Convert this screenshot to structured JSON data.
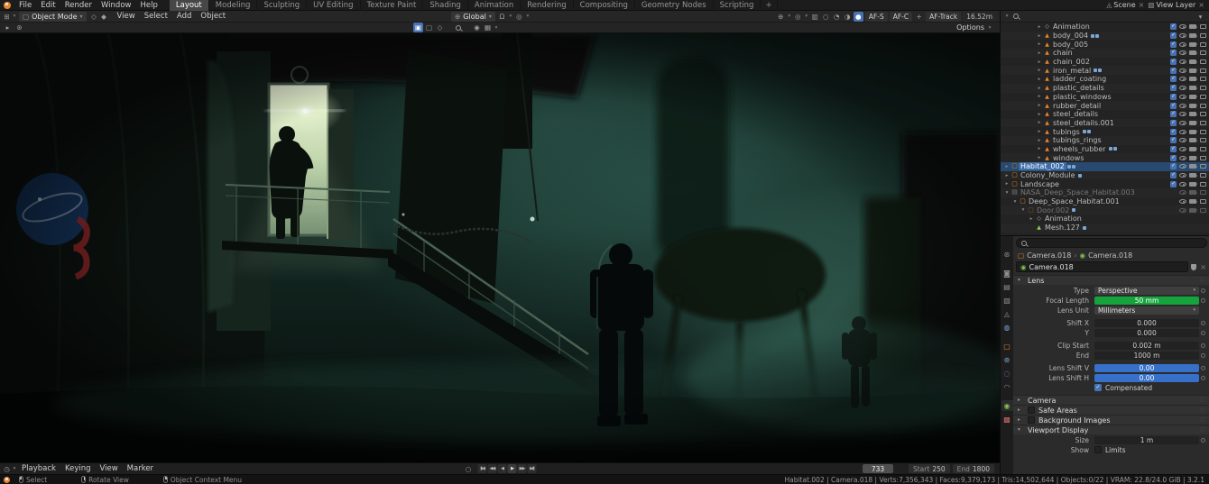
{
  "colors": {
    "accent": "#4772b3",
    "slider_green": "#15a33c",
    "field_blue": "#3670c9",
    "object_orange": "#e8862d",
    "selected_row": "#284a70"
  },
  "topbar": {
    "menus": [
      "File",
      "Edit",
      "Render",
      "Window",
      "Help"
    ],
    "workspaces": [
      {
        "label": "Layout",
        "cls": "active"
      },
      {
        "label": "Modeling",
        "cls": ""
      },
      {
        "label": "Sculpting",
        "cls": ""
      },
      {
        "label": "UV Editing",
        "cls": ""
      },
      {
        "label": "Texture Paint",
        "cls": ""
      },
      {
        "label": "Shading",
        "cls": ""
      },
      {
        "label": "Animation",
        "cls": ""
      },
      {
        "label": "Rendering",
        "cls": ""
      },
      {
        "label": "Compositing",
        "cls": ""
      },
      {
        "label": "Geometry Nodes",
        "cls": ""
      },
      {
        "label": "Scripting",
        "cls": ""
      }
    ],
    "add_workspace": "+",
    "scene": "Scene",
    "view_layer": "View Layer"
  },
  "viewport_header": {
    "mode": "Object Mode",
    "menus": [
      "View",
      "Select",
      "Add",
      "Object"
    ],
    "orientation": "Global",
    "left_icons": [
      {
        "name": "editor-type-3d-viewport-icon",
        "glyph": "⊞",
        "cls": ""
      },
      {
        "name": "mode-dropdown-icon",
        "glyph": "▾",
        "cls": "dd"
      }
    ],
    "mid_icons": [
      {
        "name": "snap-magnet-icon",
        "glyph": "Ω",
        "cls": ""
      },
      {
        "name": "snap-dropdown-icon",
        "glyph": "▾",
        "cls": "dd"
      },
      {
        "name": "proportional-editing-icon",
        "glyph": "◎",
        "cls": ""
      },
      {
        "name": "proportional-dropdown-icon",
        "glyph": "▾",
        "cls": "dd"
      }
    ],
    "right_icons": [
      {
        "name": "show-gizmo-icon",
        "glyph": "⊕",
        "cls": ""
      },
      {
        "name": "gizmo-dropdown-icon",
        "glyph": "▾",
        "cls": "dd"
      },
      {
        "name": "show-overlays-icon",
        "glyph": "◎",
        "cls": ""
      },
      {
        "name": "overlays-dropdown-icon",
        "glyph": "▾",
        "cls": "dd"
      },
      {
        "name": "toggle-xray-icon",
        "glyph": "▥",
        "cls": ""
      },
      {
        "name": "wireframe-shading-icon",
        "glyph": "○",
        "cls": ""
      },
      {
        "name": "solid-shading-icon",
        "glyph": "◔",
        "cls": ""
      },
      {
        "name": "material-preview-icon",
        "glyph": "◑",
        "cls": ""
      },
      {
        "name": "rendered-shading-icon",
        "glyph": "●",
        "cls": "active"
      }
    ],
    "af": {
      "af_s": "AF-S",
      "af_c": "AF-C",
      "af_track": "AF-Track",
      "distance": "16.52m"
    }
  },
  "tool_header": {
    "options": "Options",
    "left_icons": [
      {
        "name": "toolbar-collapse-icon",
        "glyph": "▸",
        "cls": ""
      },
      {
        "name": "active-tool-icon",
        "glyph": "⊛",
        "cls": ""
      }
    ],
    "mid_icons": [
      {
        "name": "select-mode-tweak-icon",
        "glyph": "▣",
        "cls": "active"
      },
      {
        "name": "select-mode-box-icon",
        "glyph": "▢",
        "cls": ""
      },
      {
        "name": "select-mode-circle-icon",
        "glyph": "◇",
        "cls": ""
      }
    ],
    "mid2_icons": [
      {
        "name": "transform-pivot-icon",
        "glyph": "◉",
        "cls": ""
      },
      {
        "name": "snap-target-icon",
        "glyph": "▦",
        "cls": ""
      },
      {
        "name": "tool-settings-dropdown-icon",
        "glyph": "▾",
        "cls": "dd"
      }
    ]
  },
  "outliner": {
    "rows": [
      {
        "name": "Animation",
        "icon": "anim",
        "indent": 4,
        "arrow": "r",
        "cls": "",
        "badges": 0
      },
      {
        "name": "body_004",
        "icon": "mesh",
        "indent": 4,
        "arrow": "r",
        "cls": "",
        "badges": 2
      },
      {
        "name": "body_005",
        "icon": "mesh",
        "indent": 4,
        "arrow": "r",
        "cls": "",
        "badges": 0
      },
      {
        "name": "chain",
        "icon": "mesh",
        "indent": 4,
        "arrow": "r",
        "cls": "",
        "badges": 0
      },
      {
        "name": "chain_002",
        "icon": "mesh",
        "indent": 4,
        "arrow": "r",
        "cls": "",
        "badges": 0
      },
      {
        "name": "iron_metal",
        "icon": "mesh",
        "indent": 4,
        "arrow": "r",
        "cls": "",
        "badges": 2
      },
      {
        "name": "ladder_coating",
        "icon": "mesh",
        "indent": 4,
        "arrow": "r",
        "cls": "",
        "badges": 0
      },
      {
        "name": "plastic_details",
        "icon": "mesh",
        "indent": 4,
        "arrow": "r",
        "cls": "",
        "badges": 0
      },
      {
        "name": "plastic_windows",
        "icon": "mesh",
        "indent": 4,
        "arrow": "r",
        "cls": "",
        "badges": 0
      },
      {
        "name": "rubber_detail",
        "icon": "mesh",
        "indent": 4,
        "arrow": "r",
        "cls": "",
        "badges": 0
      },
      {
        "name": "steel_details",
        "icon": "mesh",
        "indent": 4,
        "arrow": "r",
        "cls": "",
        "badges": 0
      },
      {
        "name": "steel_details.001",
        "icon": "mesh",
        "indent": 4,
        "arrow": "r",
        "cls": "",
        "badges": 0
      },
      {
        "name": "tubings",
        "icon": "mesh",
        "indent": 4,
        "arrow": "r",
        "cls": "",
        "badges": 2
      },
      {
        "name": "tubings_rings",
        "icon": "mesh",
        "indent": 4,
        "arrow": "r",
        "cls": "",
        "badges": 0
      },
      {
        "name": "wheels_rubber",
        "icon": "mesh",
        "indent": 4,
        "arrow": "r",
        "cls": "",
        "badges": 2
      },
      {
        "name": "windows",
        "icon": "mesh",
        "indent": 4,
        "arrow": "r",
        "cls": "",
        "badges": 0
      },
      {
        "name": "Habitat_002",
        "icon": "obj",
        "indent": 0,
        "arrow": "r",
        "cls": "sel",
        "badges": 2
      },
      {
        "name": "Colony_Module",
        "icon": "obj",
        "indent": 0,
        "arrow": "r",
        "cls": "",
        "badges": 1
      },
      {
        "name": "Landscape",
        "icon": "obj",
        "indent": 0,
        "arrow": "r",
        "cls": "",
        "badges": 0
      },
      {
        "name": "NASA_Deep_Space_Habitat.003",
        "icon": "coll",
        "indent": 0,
        "arrow": "d",
        "cls": "dim nocheck",
        "badges": 0
      },
      {
        "name": "Deep_Space_Habitat.001",
        "icon": "obj",
        "indent": 1,
        "arrow": "d",
        "cls": "nocheck",
        "badges": 0
      },
      {
        "name": "Door.002",
        "icon": "obj",
        "indent": 2,
        "arrow": "d",
        "cls": "dim nocheck",
        "badges": 1
      },
      {
        "name": "Animation",
        "icon": "anim",
        "indent": 3,
        "arrow": "r",
        "cls": "nocheck noctl",
        "badges": 0
      },
      {
        "name": "Mesh.127",
        "icon": "meshdata",
        "indent": 3,
        "arrow": "n",
        "cls": "nocheck noctl",
        "badges": 1
      }
    ]
  },
  "prop_tabs": [
    {
      "name": "tool-tab-icon",
      "glyph": "⊛",
      "cls": ""
    },
    {
      "name": "render-tab-icon",
      "glyph": "◙",
      "cls": "gap"
    },
    {
      "name": "output-tab-icon",
      "glyph": "▤",
      "cls": ""
    },
    {
      "name": "view-layer-tab-icon",
      "glyph": "▧",
      "cls": ""
    },
    {
      "name": "scene-tab-icon",
      "glyph": "◬",
      "cls": ""
    },
    {
      "name": "world-tab-icon",
      "glyph": "◍",
      "cls": "t-blue"
    },
    {
      "name": "object-tab-icon",
      "glyph": "▢",
      "cls": "t-orange gap"
    },
    {
      "name": "modifier-tab-icon",
      "glyph": "⊛",
      "cls": "t-blue"
    },
    {
      "name": "physics-tab-icon",
      "glyph": "◌",
      "cls": "t-blue"
    },
    {
      "name": "constraint-tab-icon",
      "glyph": "◠",
      "cls": ""
    },
    {
      "name": "object-data-tab-icon",
      "glyph": "◉",
      "cls": "t-green active gap"
    },
    {
      "name": "texture-tab-icon",
      "glyph": "▩",
      "cls": "t-red"
    }
  ],
  "properties": {
    "search_placeholder": "",
    "breadcrumb": {
      "object": "Camera.018",
      "chevron": "›",
      "data": "Camera.018"
    },
    "name_field": "Camera.018",
    "lens": {
      "title": "Lens",
      "type_label": "Type",
      "type": "Perspective",
      "focal_label": "Focal Length",
      "focal": "50 mm",
      "unit_label": "Lens Unit",
      "unit": "Millimeters",
      "shift_x_label": "Shift X",
      "shift_x": "0.000",
      "shift_y_label": "Y",
      "shift_y": "0.000",
      "clip_start_label": "Clip Start",
      "clip_start": "0.002 m",
      "clip_end_label": "End",
      "clip_end": "1000 m",
      "lsv_label": "Lens Shift V",
      "lsv": "0.00",
      "lsh_label": "Lens Shift H",
      "lsh": "0.00",
      "comp_label": "Compensated"
    },
    "collapsed_panels": [
      {
        "title": "Camera",
        "chk": ""
      },
      {
        "title": "Safe Areas",
        "chk": "haschk"
      },
      {
        "title": "Background Images",
        "chk": "haschk"
      }
    ],
    "viewport_display": {
      "title": "Viewport Display",
      "size_label": "Size",
      "size": "1 m",
      "show_label": "Show",
      "limits_label": "Limits"
    }
  },
  "timeline": {
    "menus": [
      "Playback",
      "Keying",
      "View",
      "Marker"
    ],
    "auto_key_icon": "○",
    "transport": [
      {
        "name": "jump-to-start-button",
        "glyph": "▮◀",
        "cls": ""
      },
      {
        "name": "prev-keyframe-button",
        "glyph": "◀◀",
        "cls": ""
      },
      {
        "name": "play-reverse-button",
        "glyph": "◀",
        "cls": ""
      },
      {
        "name": "play-button",
        "glyph": "▶",
        "cls": "play"
      },
      {
        "name": "next-keyframe-button",
        "glyph": "▶▶",
        "cls": ""
      },
      {
        "name": "jump-to-end-button",
        "glyph": "▶▮",
        "cls": ""
      }
    ],
    "frame": "733",
    "start_label": "Start",
    "start": "250",
    "end_label": "End",
    "end": "1800"
  },
  "statusbar": {
    "hints": [
      {
        "label": "Select",
        "btn": "l",
        "name": "hint-select"
      },
      {
        "label": "Rotate View",
        "btn": "m",
        "name": "hint-rotate-view"
      },
      {
        "label": "Object Context Menu",
        "btn": "r",
        "name": "hint-context-menu"
      }
    ],
    "stats": [
      "Habitat.002",
      "Camera.018",
      "Verts:7,356,343",
      "Faces:9,379,173",
      "Tris:14,502,644",
      "Objects:0/22",
      "VRAM: 22.8/24.0 GiB",
      "3.2.1"
    ]
  }
}
